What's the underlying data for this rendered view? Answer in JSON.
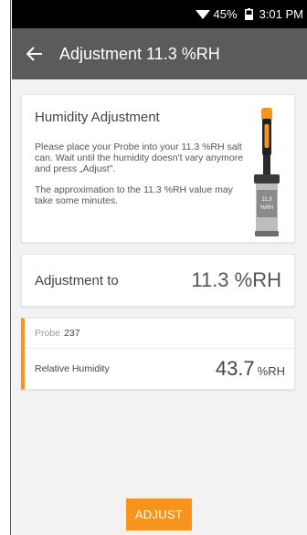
{
  "status_bar": {
    "battery_percent": "45%",
    "time": "3:01 PM"
  },
  "app_bar": {
    "title": "Adjustment 11.3 %RH"
  },
  "info_card": {
    "heading": "Humidity Adjustment",
    "paragraph1": "Please place your Probe into your 11.3 %RH salt can. Wait until the humidity doesn't vary anymore and press „Adjust\".",
    "paragraph2": "The approximation to the 11.3 %RH value may take some minutes.",
    "salt_can_label": "11.3 %RH"
  },
  "adjustment_card": {
    "label": "Adjustment to",
    "value": "11.3 %RH"
  },
  "probe_card": {
    "probe_word": "Probe",
    "probe_number": "237",
    "measurement_label": "Relative Humidity",
    "measurement_value": "43.7",
    "measurement_unit": "%RH"
  },
  "actions": {
    "adjust_label": "ADJUST"
  },
  "colors": {
    "accent": "#f7941d",
    "app_bar": "#5b5b5b",
    "status_bar": "#000000",
    "background": "#f2f2f2"
  }
}
